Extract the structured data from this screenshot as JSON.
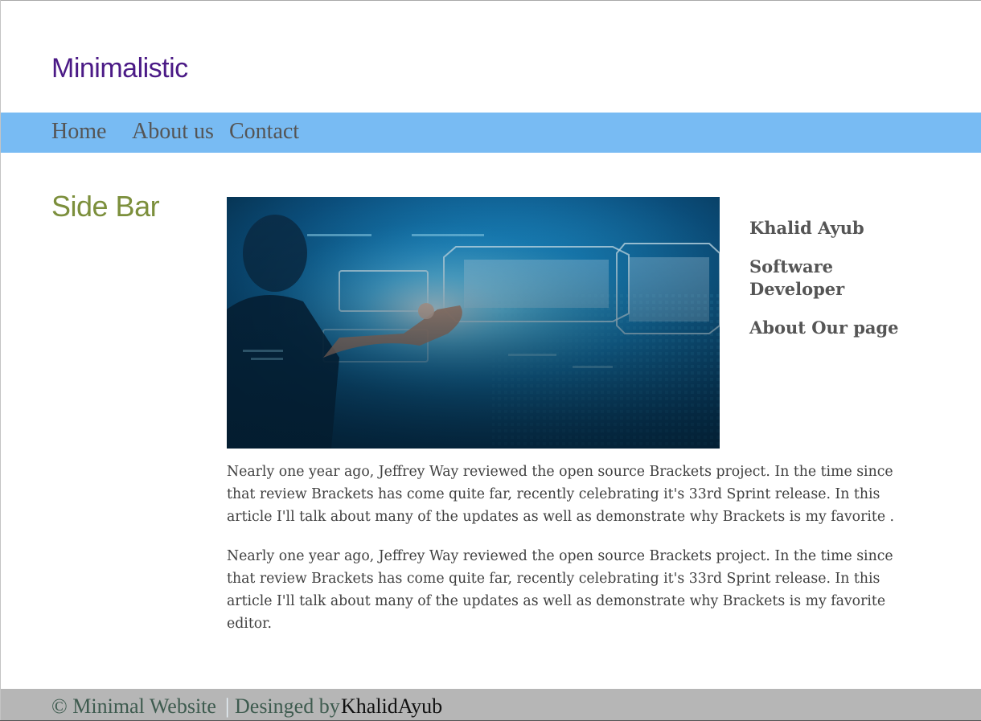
{
  "site": {
    "title": "Minimalistic"
  },
  "nav": {
    "items": [
      {
        "label": "Home"
      },
      {
        "label": "About us"
      },
      {
        "label": "Contact"
      }
    ]
  },
  "sidebar": {
    "title": "Side Bar"
  },
  "hero": {
    "icon": "tech-touchscreen-image"
  },
  "profile": {
    "name": "Khalid Ayub",
    "role_line1": "Software",
    "role_line2": "Developer",
    "about": "About Our page"
  },
  "article": {
    "paragraphs": [
      "Nearly one year ago, Jeffrey Way reviewed the open source Brackets project. In the time since that review Brackets has come quite far, recently celebrating it's 33rd Sprint release. In this article I'll talk about many of the updates as well as demonstrate why Brackets is my favorite .",
      "Nearly one year ago, Jeffrey Way reviewed the open source Brackets project. In the time since that review Brackets has come quite far, recently celebrating it's 33rd Sprint release. In this article I'll talk about many of the updates as well as demonstrate why Brackets is my favorite editor."
    ]
  },
  "footer": {
    "copyright": "© Minimal Website",
    "separator": "|",
    "designed_by": "Desinged by",
    "author": "KhalidAyub"
  },
  "colors": {
    "title": "#4b1a86",
    "nav_bg": "#78bbf3",
    "sidebar_title": "#7c8f3c",
    "footer_bg": "#b6b6b6"
  }
}
